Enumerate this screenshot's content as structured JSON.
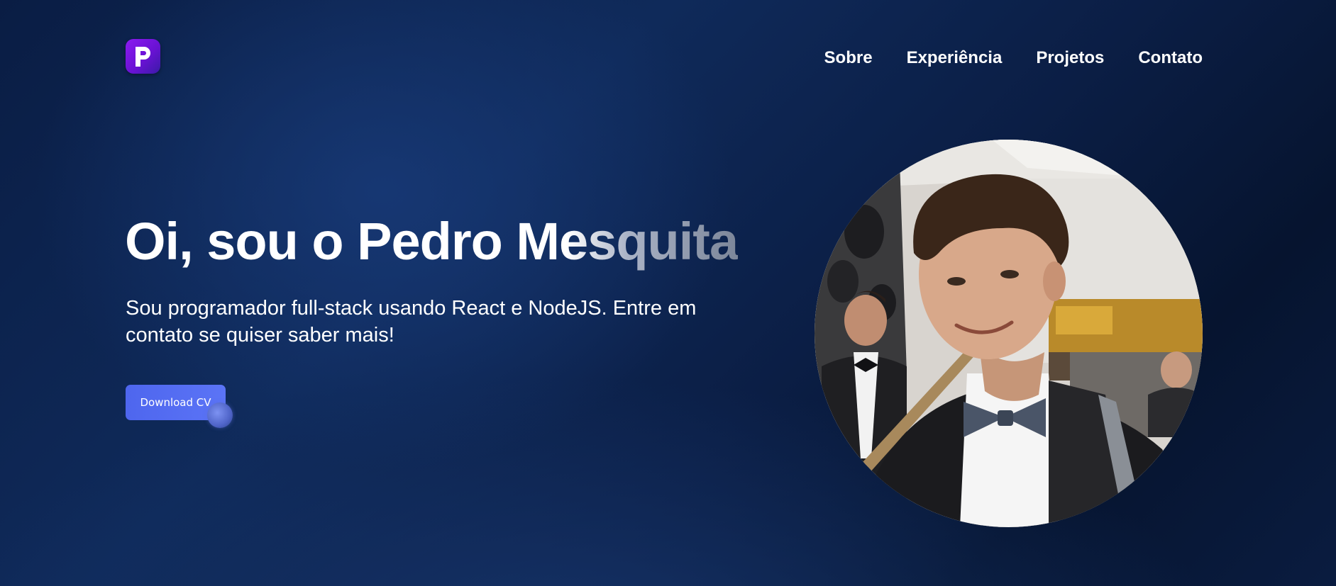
{
  "header": {
    "logo_icon": "p-letter-logo-icon",
    "nav": [
      {
        "label": "Sobre"
      },
      {
        "label": "Experiência"
      },
      {
        "label": "Projetos"
      },
      {
        "label": "Contato"
      }
    ]
  },
  "hero": {
    "title": "Oi, sou o Pedro Mesquita",
    "subtitle": "Sou programador full-stack usando React e NodeJS. Entre em contato se quiser saber mais!",
    "download_label": "Download CV"
  },
  "colors": {
    "background": "#0f2a5a",
    "accent": "#5b74f6",
    "logo": "#8b1bf0"
  }
}
